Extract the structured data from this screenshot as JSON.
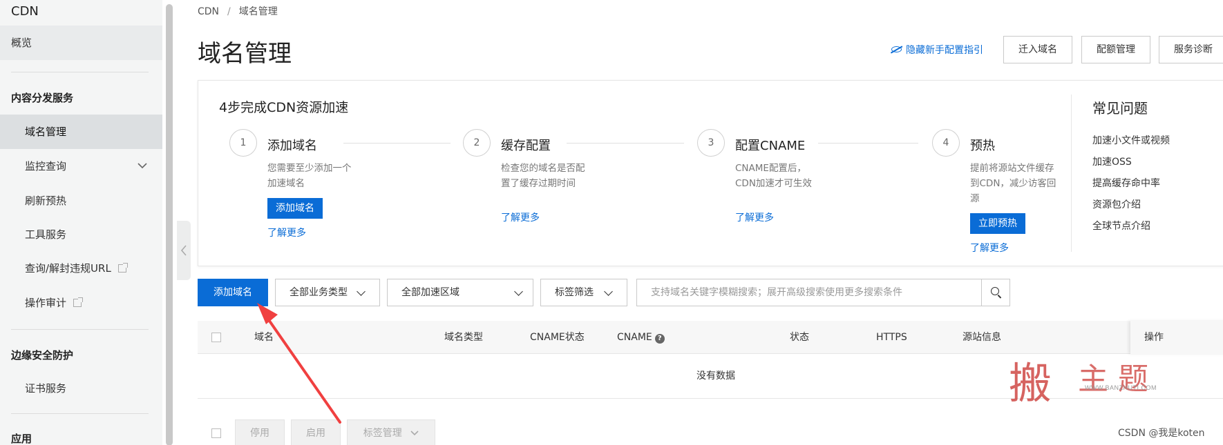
{
  "sidebar": {
    "title": "CDN",
    "overview": "概览",
    "sections": [
      {
        "label": "内容分发服务"
      },
      {
        "label": "边缘安全防护"
      },
      {
        "label": "应用"
      }
    ],
    "items": {
      "domain_mgmt": "域名管理",
      "monitor": "监控查询",
      "refresh": "刷新预热",
      "tools": "工具服务",
      "query_unblock": "查询/解封违规URL",
      "audit": "操作审计",
      "cert": "证书服务"
    }
  },
  "breadcrumb": {
    "root": "CDN",
    "sep": "/",
    "current": "域名管理"
  },
  "page": {
    "title": "域名管理"
  },
  "header": {
    "guide_link": "隐藏新手配置指引",
    "buttons": {
      "migrate": "迁入域名",
      "quota": "配额管理",
      "diagnose": "服务诊断"
    }
  },
  "steps": {
    "heading": "4步完成CDN资源加速",
    "items": [
      {
        "num": "1",
        "title": "添加域名",
        "desc": "您需要至少添加一个加速域名",
        "button": "添加域名",
        "link": "了解更多"
      },
      {
        "num": "2",
        "title": "缓存配置",
        "desc": "检查您的域名是否配置了缓存过期时间",
        "link": "了解更多"
      },
      {
        "num": "3",
        "title": "配置CNAME",
        "desc": "CNAME配置后，CDN加速才可生效",
        "link": "了解更多"
      },
      {
        "num": "4",
        "title": "预热",
        "desc": "提前将源站文件缓存到CDN，减少访客回源",
        "button": "立即预热",
        "link": "了解更多"
      }
    ]
  },
  "faq": {
    "title": "常见问题",
    "items": [
      "加速小文件或视频",
      "加速OSS",
      "提高缓存命中率",
      "资源包介绍",
      "全球节点介绍"
    ]
  },
  "toolbar": {
    "add_button": "添加域名",
    "business_type": "全部业务类型",
    "region": "全部加速区域",
    "tag_filter": "标签筛选",
    "search_placeholder": "支持域名关键字模糊搜索；展开高级搜索使用更多搜索条件"
  },
  "table": {
    "columns": {
      "domain": "域名",
      "type": "域名类型",
      "cname_status": "CNAME状态",
      "cname": "CNAME",
      "status": "状态",
      "https": "HTTPS",
      "origin": "源站信息",
      "actions": "操作"
    },
    "help_glyph": "?",
    "empty_text": "没有数据"
  },
  "batch": {
    "disable": "停用",
    "enable": "启用",
    "tag_mgmt": "标签管理"
  },
  "watermark": {
    "chars": [
      "搬",
      "主",
      "题"
    ],
    "url": "WWW.BANZHUTI.COM"
  },
  "credit": "CSDN @我是koten",
  "colors": {
    "primary": "#0a6cd6",
    "annotation_arrow": "#f04040",
    "watermark": "#c9302c"
  }
}
